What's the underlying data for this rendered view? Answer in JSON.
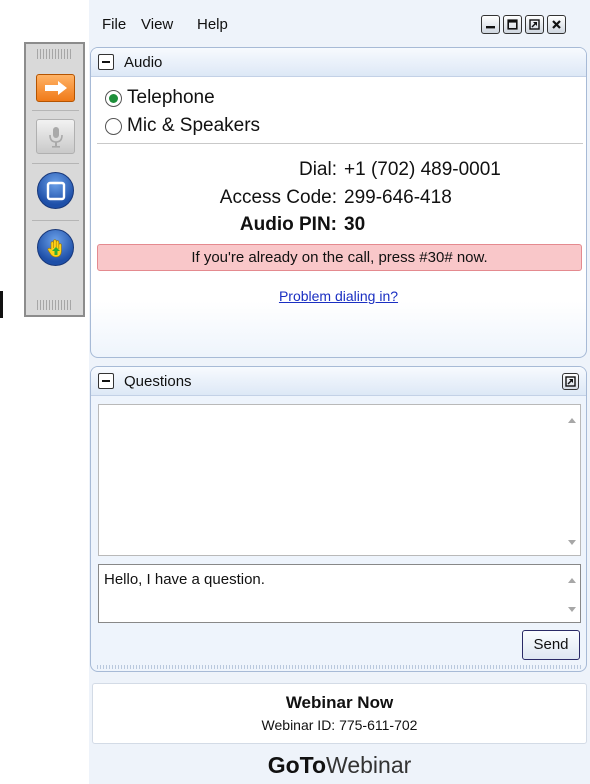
{
  "menu": {
    "file": "File",
    "view": "View",
    "help": "Help"
  },
  "window_controls": [
    "minimize-icon",
    "maximize-icon",
    "restore-icon",
    "close-icon"
  ],
  "toolbar": {
    "buttons": [
      {
        "icon": "arrow-right-icon",
        "color": "#f07a18"
      },
      {
        "icon": "microphone-icon",
        "state": "disabled"
      },
      {
        "icon": "screen-icon",
        "color": "#1e4fa8"
      },
      {
        "icon": "raise-hand-icon",
        "color": "#1e4fa8"
      }
    ]
  },
  "audio": {
    "title": "Audio",
    "options": [
      {
        "label": "Telephone",
        "selected": true
      },
      {
        "label": "Mic & Speakers",
        "selected": false
      }
    ],
    "dial_label": "Dial:",
    "dial_value": "+1 (702) 489-0001",
    "access_code_label": "Access Code:",
    "access_code_value": "299-646-418",
    "pin_label": "Audio PIN:",
    "pin_value": "30",
    "notice": "If you're already on the call, press #30# now.",
    "notice_color": "#f9c7c9",
    "problem_link": "Problem dialing in?"
  },
  "questions": {
    "title": "Questions",
    "input_value": "Hello, I have a question.",
    "send_label": "Send"
  },
  "webinar": {
    "title": "Webinar Now",
    "id_text": "Webinar ID: 775-611-702"
  },
  "brand": {
    "bold": "GoTo",
    "light": "Webinar"
  }
}
